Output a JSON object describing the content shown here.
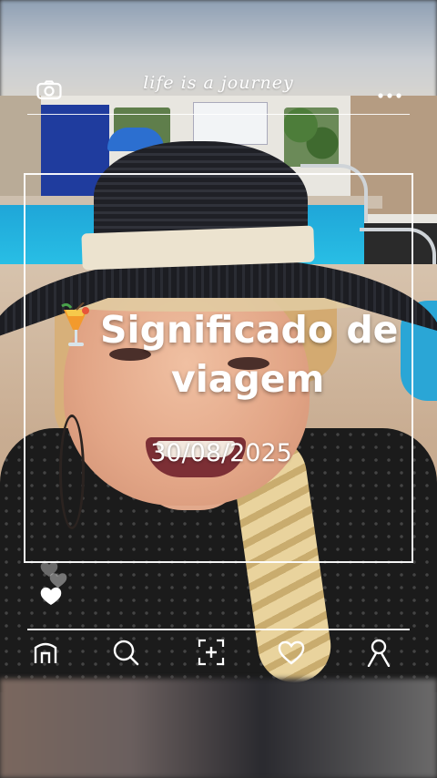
{
  "header": {
    "title": "life is a journey",
    "left_icon": "camera-icon",
    "right_icon": "more-dots-icon"
  },
  "post": {
    "emoji_icon": "tropical-drink-icon",
    "headline_line1": "Significado de",
    "headline_line2": "viagem",
    "date": "30/08/2025"
  },
  "side_actions": {
    "icons": [
      "heart-outline-icon",
      "heart-outline-icon",
      "heart-filled-icon"
    ]
  },
  "bottom_nav": {
    "items": [
      {
        "icon": "home-icon"
      },
      {
        "icon": "search-icon"
      },
      {
        "icon": "add-photo-icon"
      },
      {
        "icon": "heart-icon"
      },
      {
        "icon": "profile-icon"
      }
    ]
  },
  "colors": {
    "overlay_text": "#ffffff",
    "pool": "#1fa6d8",
    "hat": "#1f2026"
  }
}
